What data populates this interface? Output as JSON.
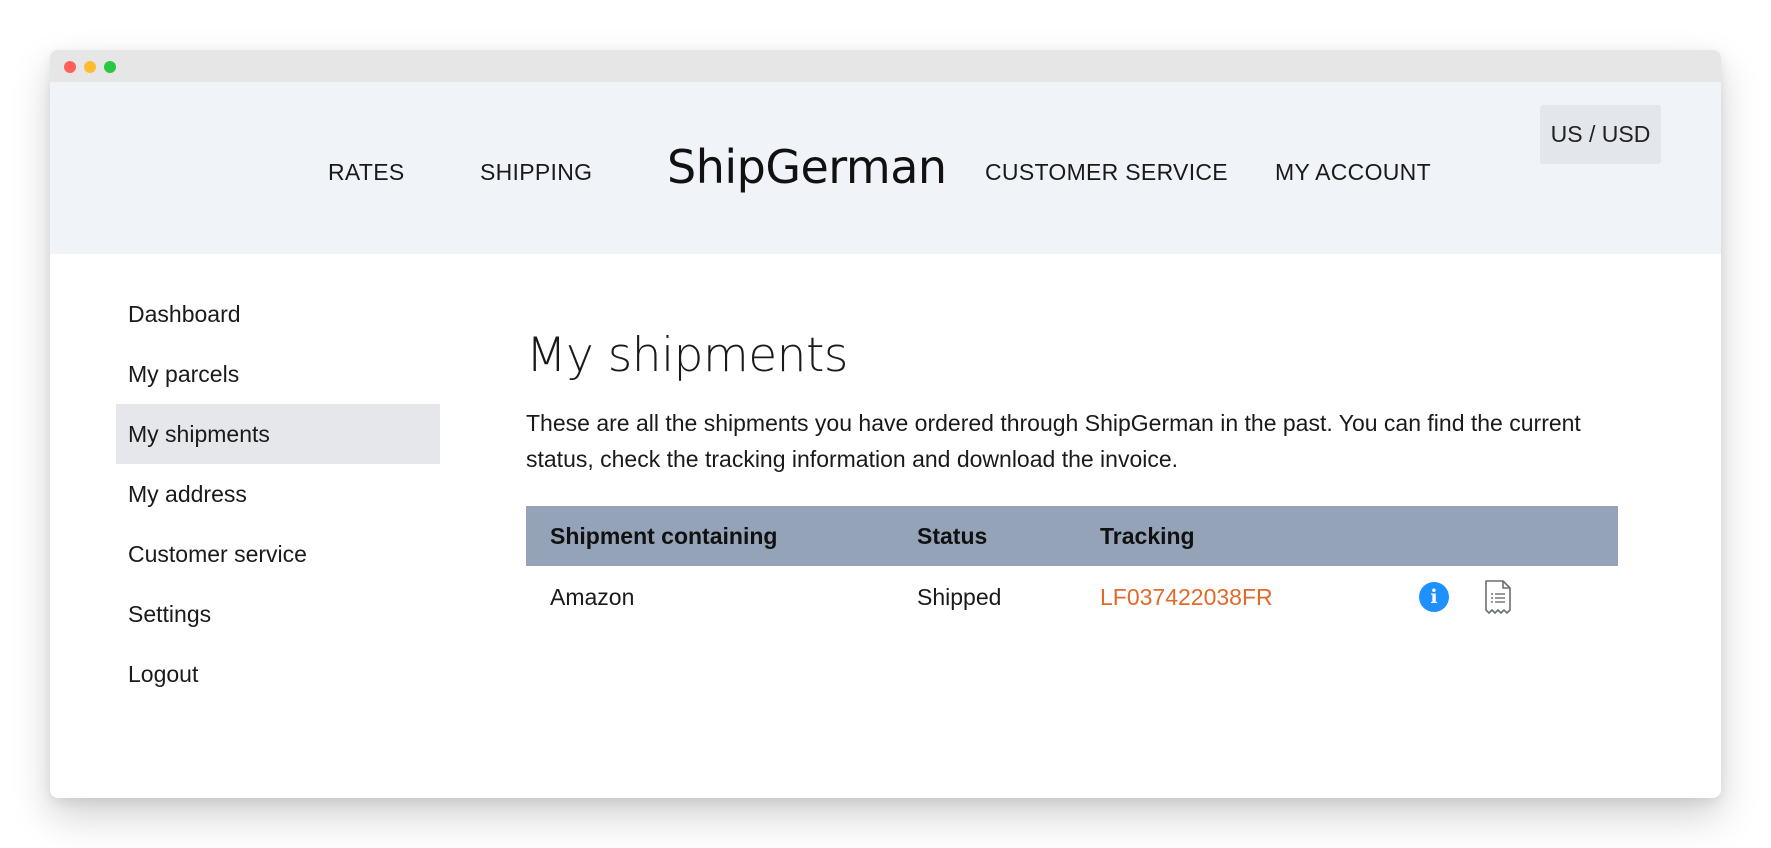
{
  "header": {
    "nav": {
      "rates": "RATES",
      "shipping": "SHIPPING",
      "customer_service": "CUSTOMER SERVICE",
      "my_account": "MY ACCOUNT"
    },
    "logo": "ShipGerman",
    "currency": "US / USD"
  },
  "sidebar": {
    "items": [
      {
        "label": "Dashboard"
      },
      {
        "label": "My parcels"
      },
      {
        "label": "My shipments"
      },
      {
        "label": "My address"
      },
      {
        "label": "Customer service"
      },
      {
        "label": "Settings"
      },
      {
        "label": "Logout"
      }
    ],
    "active": "My shipments"
  },
  "main": {
    "title": "My shipments",
    "intro": "These are all the shipments you have ordered through ShipGerman in the past. You can find the current status, check the tracking information and download the invoice."
  },
  "table": {
    "headers": {
      "shipment": "Shipment containing",
      "status": "Status",
      "tracking": "Tracking"
    },
    "rows": [
      {
        "shipment": "Amazon",
        "status": "Shipped",
        "tracking": "LF037422038FR"
      }
    ]
  },
  "colors": {
    "header_bg": "#f0f3f8",
    "table_header_bg": "#94a3b8",
    "tracking_link": "#e06a2b",
    "info_icon": "#1e90ff",
    "active_sidebar_bg": "#e5e7eb"
  },
  "icons": {
    "info": "info-icon",
    "invoice": "invoice-icon"
  }
}
